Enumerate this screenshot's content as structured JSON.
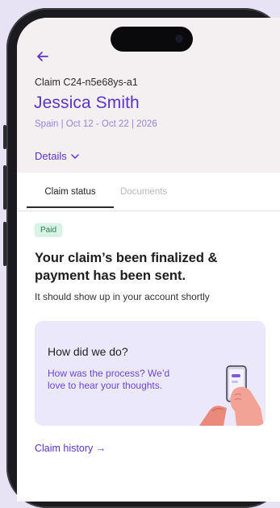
{
  "header": {
    "claim_id": "Claim C24-n5e68ys-a1",
    "claimant_name": "Jessica Smith",
    "trip_info": "Spain | Oct 12 - Oct 22 | 2026",
    "details_label": "Details"
  },
  "tabs": [
    {
      "label": "Claim status",
      "active": true
    },
    {
      "label": "Documents",
      "active": false
    }
  ],
  "status": {
    "badge": "Paid",
    "headline": "Your claim’s been finalized & payment has been sent.",
    "subtext": "It should show up in your account shortly"
  },
  "feedback": {
    "title": "How did we do?",
    "body": "How was the process? We’d love to hear your thoughts."
  },
  "claim_history_label": "Claim history →",
  "colors": {
    "brand_purple": "#5b34c4",
    "light_purple": "#9a84e0",
    "header_bg": "#f4eff0",
    "card_bg": "#ece8fb",
    "paid_badge_bg": "#d8f3e6",
    "paid_badge_text": "#2f7b56",
    "page_bg": "#e7e3f5"
  },
  "icons": {
    "back": "arrow-left-icon",
    "details": "chevron-down-icon",
    "feedback_illustration": "hand-holding-phone-icon"
  }
}
